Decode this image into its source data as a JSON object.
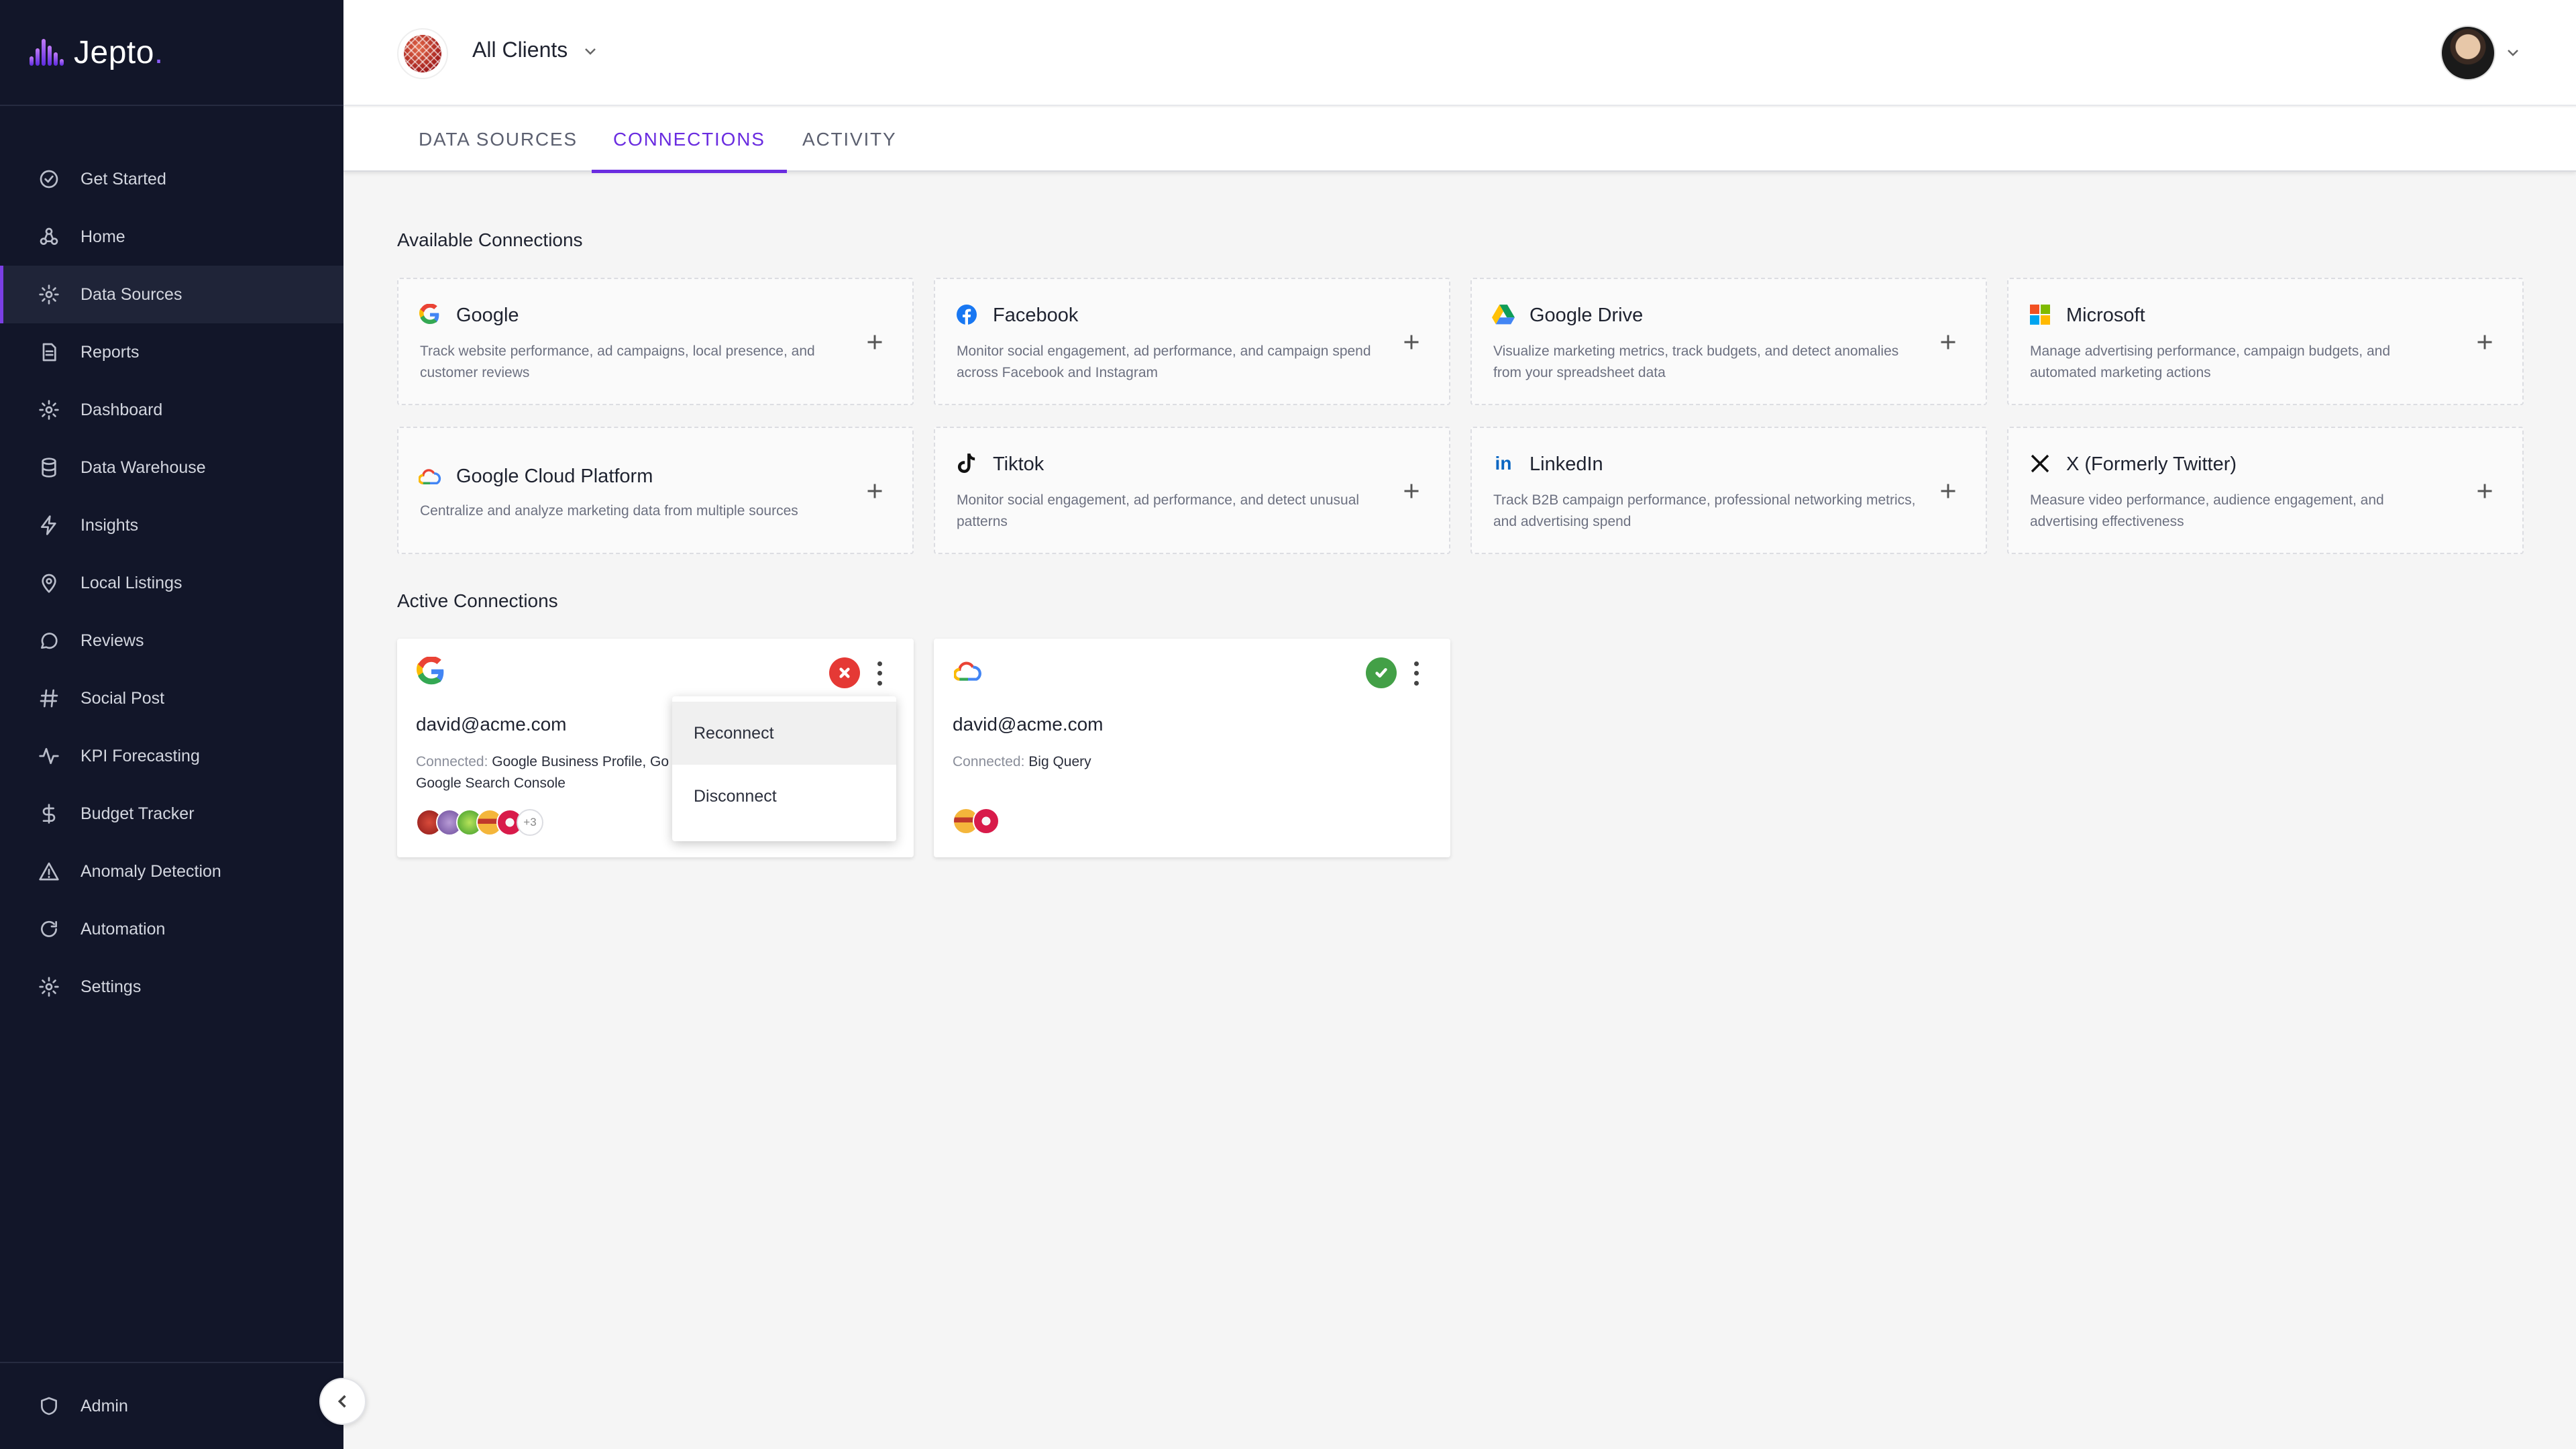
{
  "app": {
    "brand_name": "Jepto",
    "brand_dot": ".",
    "brand_accent": "#7b3fe4"
  },
  "sidebar": {
    "items": [
      {
        "label": "Get Started",
        "icon": "check-circle-icon"
      },
      {
        "label": "Home",
        "icon": "home-nodes-icon"
      },
      {
        "label": "Data Sources",
        "icon": "gear-icon",
        "active": true
      },
      {
        "label": "Reports",
        "icon": "document-icon"
      },
      {
        "label": "Dashboard",
        "icon": "gear-icon"
      },
      {
        "label": "Data Warehouse",
        "icon": "database-icon"
      },
      {
        "label": "Insights",
        "icon": "lightning-icon"
      },
      {
        "label": "Local Listings",
        "icon": "map-pin-icon"
      },
      {
        "label": "Reviews",
        "icon": "chat-bubble-icon"
      },
      {
        "label": "Social Post",
        "icon": "hashtag-icon"
      },
      {
        "label": "KPI Forecasting",
        "icon": "pulse-icon"
      },
      {
        "label": "Budget Tracker",
        "icon": "dollar-icon"
      },
      {
        "label": "Anomaly Detection",
        "icon": "warning-triangle-icon"
      },
      {
        "label": "Automation",
        "icon": "refresh-icon"
      },
      {
        "label": "Settings",
        "icon": "gear-icon"
      }
    ],
    "admin_label": "Admin"
  },
  "header": {
    "client_selector": "All Clients"
  },
  "tabs": [
    {
      "label": "DATA SOURCES"
    },
    {
      "label": "CONNECTIONS",
      "active": true
    },
    {
      "label": "ACTIVITY"
    }
  ],
  "available": {
    "title": "Available Connections",
    "cards": [
      {
        "title": "Google",
        "desc": "Track website performance, ad campaigns, local presence, and customer reviews",
        "icon": "google-icon"
      },
      {
        "title": "Facebook",
        "desc": "Monitor social engagement, ad performance, and campaign spend across Facebook and Instagram",
        "icon": "facebook-icon"
      },
      {
        "title": "Google Drive",
        "desc": "Visualize marketing metrics, track budgets, and detect anomalies from your spreadsheet data",
        "icon": "google-drive-icon"
      },
      {
        "title": "Microsoft",
        "desc": "Manage advertising performance, campaign budgets, and automated marketing actions",
        "icon": "microsoft-icon"
      },
      {
        "title": "Google Cloud Platform",
        "desc": "Centralize and analyze marketing data from multiple sources",
        "icon": "google-cloud-icon"
      },
      {
        "title": "Tiktok",
        "desc": "Monitor social engagement, ad performance, and detect unusual patterns",
        "icon": "tiktok-icon"
      },
      {
        "title": "LinkedIn",
        "desc": "Track B2B campaign performance, professional networking metrics, and advertising spend",
        "icon": "linkedin-icon"
      },
      {
        "title": "X (Formerly Twitter)",
        "desc": "Measure video performance, audience engagement, and advertising effectiveness",
        "icon": "x-icon"
      }
    ]
  },
  "active": {
    "title": "Active Connections",
    "cards": [
      {
        "email": "david@acme.com",
        "connected_label": "Connected:",
        "connected_value": "Google Business Profile, Go",
        "connected_line2": "Google Search Console",
        "status": "error",
        "more_count": "+3"
      },
      {
        "email": "david@acme.com",
        "connected_label": "Connected:",
        "connected_value": "Big Query",
        "status": "ok"
      }
    ]
  },
  "dropdown": {
    "items": [
      "Reconnect",
      "Disconnect"
    ]
  },
  "colors": {
    "error": "#e53935",
    "ok": "#43a047",
    "tab_active": "#6a2ce0",
    "sidebar_bg": "#121629"
  }
}
